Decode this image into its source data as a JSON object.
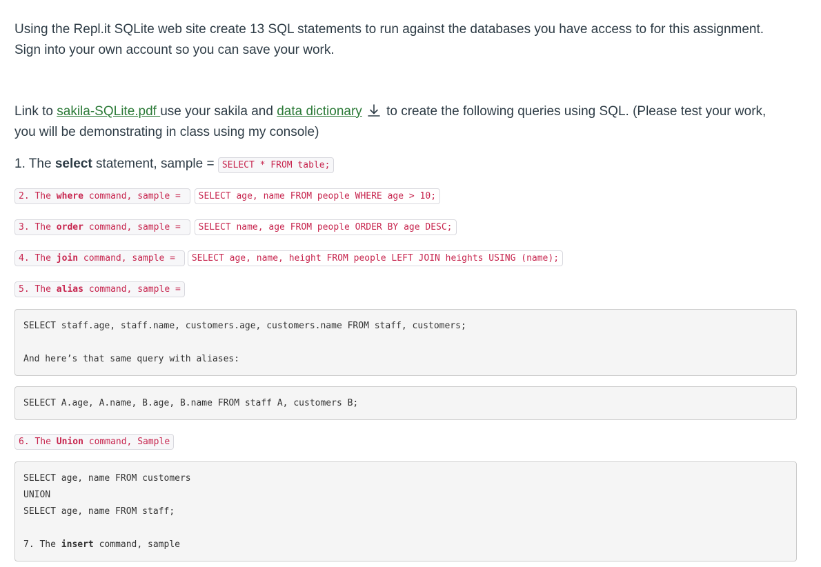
{
  "intro": {
    "line1": "Using the Repl.it SQLite web site create 13 SQL statements to run against the databases you have access to for this assignment.",
    "line2": "Sign into your own account so you can save your work."
  },
  "link_paragraph": {
    "prefix": "Link to ",
    "link1": "sakila-SQLite.pdf ",
    "middle": "use your sakila and ",
    "link2": "data dictionary",
    "suffix_line1": " to create the following queries using SQL. (Please test your work,",
    "line2": "you will be demonstrating in class using my console)",
    "download_icon": "download-icon"
  },
  "item1": {
    "prefix": "1. The ",
    "keyword": "select",
    "suffix": " statement,  sample = ",
    "code": "SELECT * FROM table;"
  },
  "item2": {
    "prefix": "2. The ",
    "keyword": "where",
    "suffix": " command, sample = ",
    "code": "SELECT age, name FROM people WHERE age > 10;"
  },
  "item3": {
    "prefix": "3. The ",
    "keyword": "order",
    "suffix": " command, sample = ",
    "code": "SELECT name, age FROM people ORDER BY age DESC;"
  },
  "item4": {
    "prefix": "4. The ",
    "keyword": "join",
    "suffix": " command, sample = ",
    "code": "SELECT age, name, height FROM people LEFT JOIN heights USING (name);"
  },
  "item5": {
    "prefix": "5. The ",
    "keyword": "alias",
    "suffix": " command, sample ="
  },
  "block_alias": {
    "line1": "SELECT staff.age, staff.name, customers.age, customers.name FROM staff, customers;",
    "line2": "And here’s that same query with aliases:"
  },
  "block_alias2": {
    "line1": "SELECT A.age, A.name, B.age, B.name FROM staff A, customers B;"
  },
  "item6": {
    "prefix": "6. The ",
    "keyword": "Union",
    "suffix": " command, Sample"
  },
  "block_union": {
    "line1": "SELECT age, name FROM customers",
    "line2": "UNION",
    "line3": "SELECT age, name FROM staff;",
    "item7_prefix": "7. The ",
    "item7_keyword": "insert",
    "item7_suffix": " command, sample"
  },
  "colors": {
    "text": "#2d3b45",
    "link": "#2b7a37",
    "code": "#c7254e",
    "pre_bg": "#f5f5f5"
  }
}
